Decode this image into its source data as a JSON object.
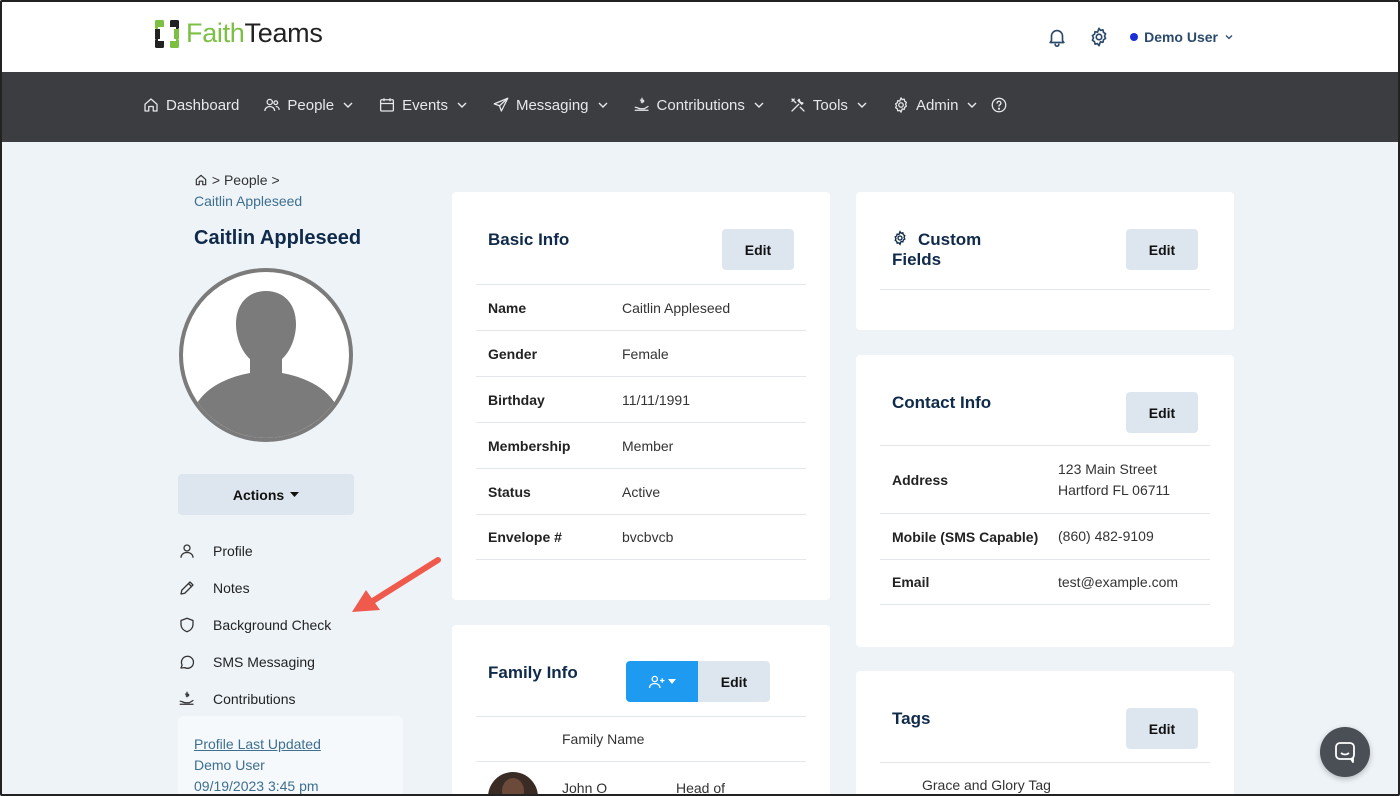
{
  "brand": {
    "name_part1": "Faith",
    "name_part2": "Teams"
  },
  "header": {
    "user_name": "Demo User"
  },
  "nav": [
    {
      "label": "Dashboard"
    },
    {
      "label": "People"
    },
    {
      "label": "Events"
    },
    {
      "label": "Messaging"
    },
    {
      "label": "Contributions"
    },
    {
      "label": "Tools"
    },
    {
      "label": "Admin"
    }
  ],
  "breadcrumb": {
    "sep1": ">",
    "people": "People",
    "sep2": ">",
    "current": "Caitlin Appleseed"
  },
  "person": {
    "name": "Caitlin Appleseed"
  },
  "actions": {
    "label": "Actions"
  },
  "side_menu": [
    {
      "label": "Profile"
    },
    {
      "label": "Notes"
    },
    {
      "label": "Background Check"
    },
    {
      "label": "SMS Messaging"
    },
    {
      "label": "Contributions"
    }
  ],
  "updated": {
    "title": "Profile Last Updated",
    "by": "Demo User",
    "when": "09/19/2023 3:45 pm"
  },
  "basic_info": {
    "title": "Basic Info",
    "edit": "Edit",
    "rows": [
      {
        "k": "Name",
        "v": "Caitlin Appleseed"
      },
      {
        "k": "Gender",
        "v": "Female"
      },
      {
        "k": "Birthday",
        "v": "11/11/1991"
      },
      {
        "k": "Membership",
        "v": "Member"
      },
      {
        "k": "Status",
        "v": "Active"
      },
      {
        "k": "Envelope #",
        "v": "bvcbvcb"
      }
    ]
  },
  "custom_fields": {
    "title_line1": "Custom",
    "title_line2": "Fields",
    "edit": "Edit"
  },
  "contact_info": {
    "title": "Contact Info",
    "edit": "Edit",
    "address_label": "Address",
    "address_line1": "123 Main Street",
    "address_line2": "Hartford FL 06711",
    "mobile_label": "Mobile (SMS Capable)",
    "mobile": "(860) 482-9109",
    "email_label": "Email",
    "email": "test@example.com"
  },
  "family_info": {
    "title": "Family Info",
    "edit": "Edit",
    "column_header": "Family Name",
    "member_name": "John O",
    "member_role": "Head of"
  },
  "tags": {
    "title": "Tags",
    "edit": "Edit",
    "first_tag": "Grace and Glory Tag"
  },
  "colors": {
    "accent_green": "#7cc043",
    "nav_bg": "#3b3d40",
    "primary_blue": "#1e9bf0",
    "title_navy": "#0f2a4a"
  }
}
